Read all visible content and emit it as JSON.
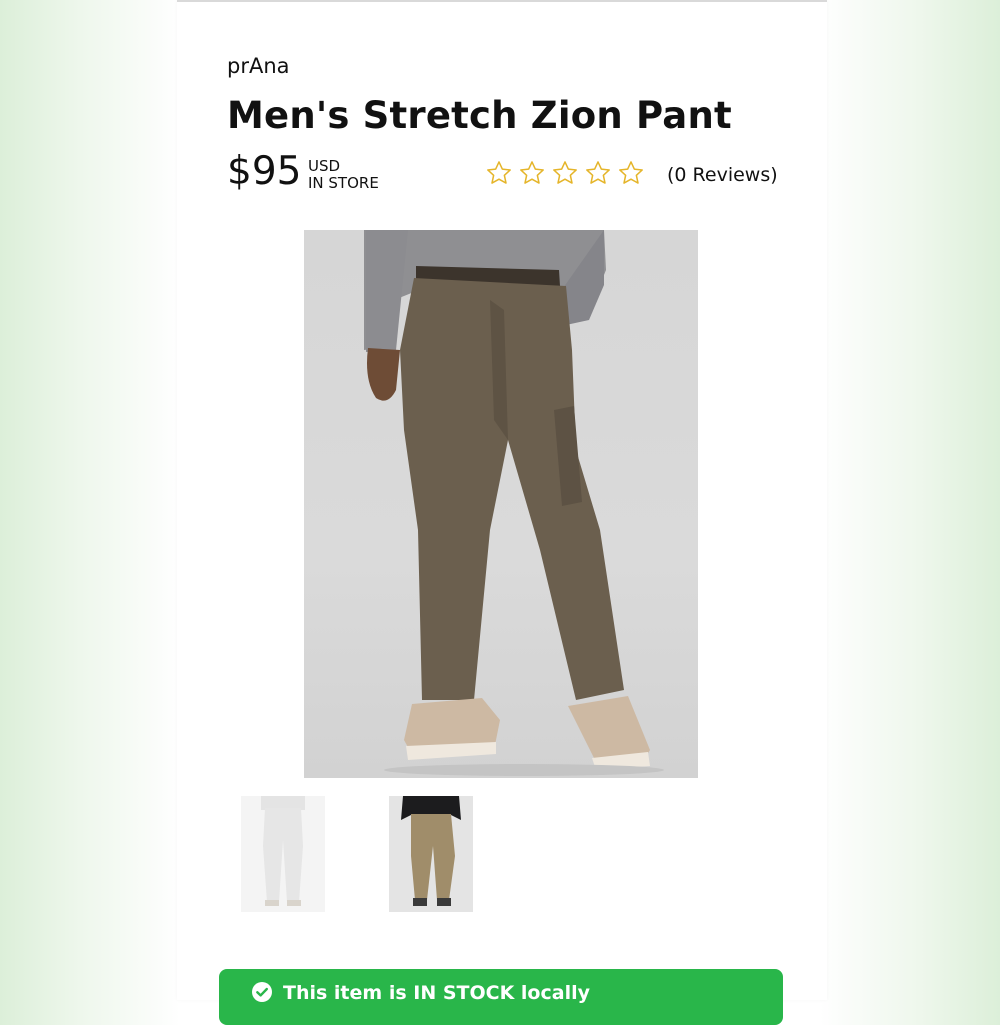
{
  "product": {
    "brand": "prAna",
    "title": "Men's Stretch Zion Pant",
    "price": "$95",
    "currency": "USD",
    "availability_label": "IN STORE",
    "rating": {
      "stars_filled": 0,
      "stars_total": 5,
      "reviews_label": "(0 Reviews)"
    },
    "images": {
      "main": "model-wearing-brown-pants-photo",
      "thumbnails": [
        "white-pants-thumbnail",
        "khaki-pants-thumbnail"
      ]
    }
  },
  "stock_banner": {
    "text": "This item is IN STOCK locally",
    "icon": "check-circle-icon",
    "color": "#29b64a"
  },
  "colors": {
    "star_outline": "#e5b52a",
    "pant_main": "#6b5f4e",
    "pant_khaki": "#a08d6a"
  }
}
